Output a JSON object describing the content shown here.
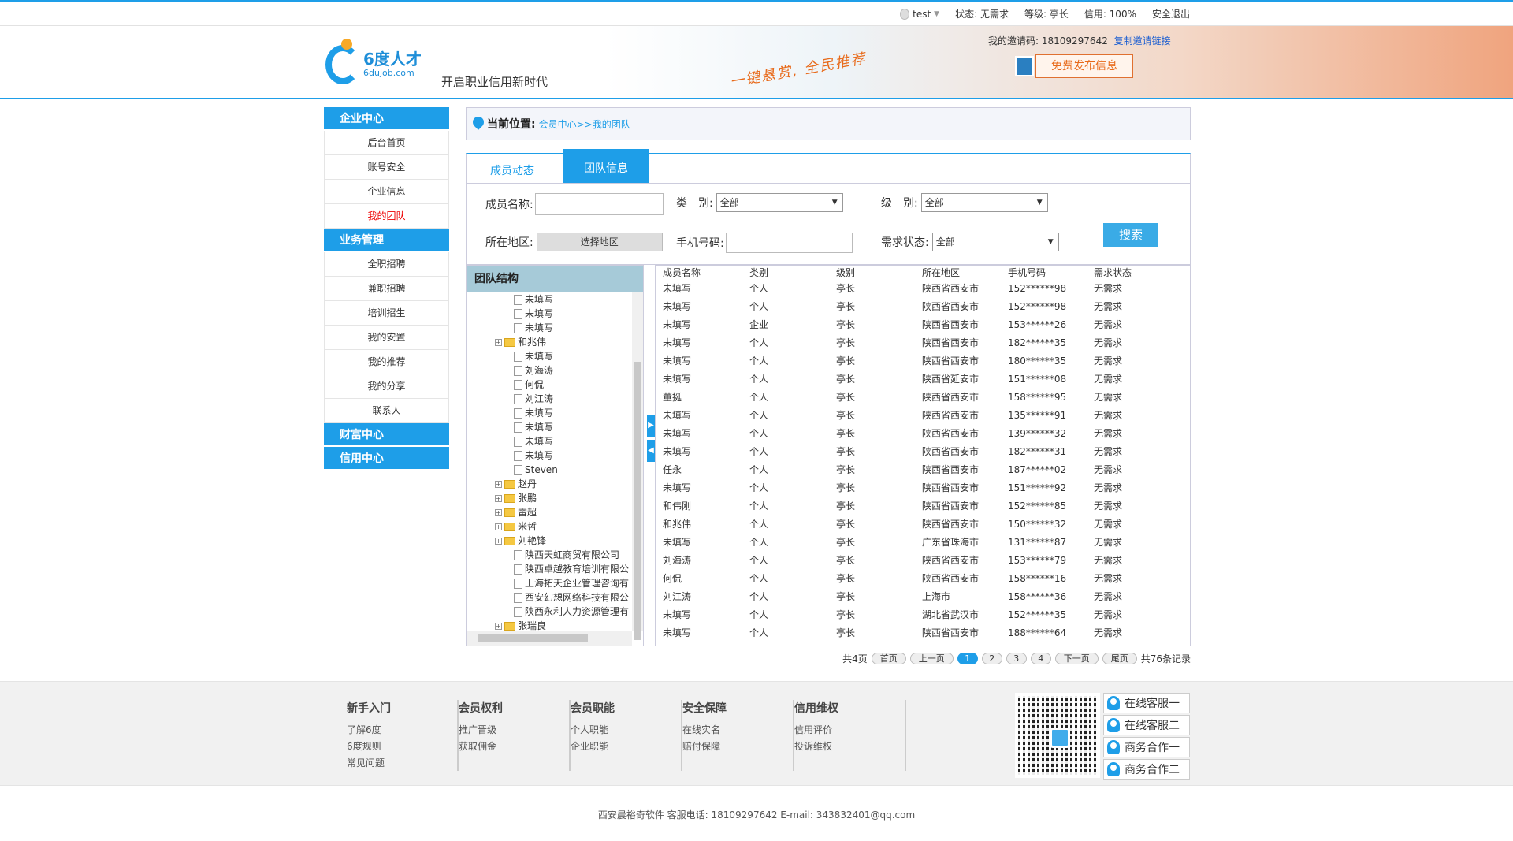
{
  "topbar": {
    "user": "test",
    "status": "状态: 无需求",
    "level": "等级: 亭长",
    "credit": "信用: 100%",
    "logout": "安全退出"
  },
  "banner": {
    "logo_cn": "6度人才",
    "logo_en": "6dujob.com",
    "slogan": "开启职业信用新时代",
    "script_text": "一键悬赏, 全民推荐",
    "invite_label": "我的邀请码: 18109297642",
    "invite_link": "复制邀请链接",
    "publish_button": "免费发布信息"
  },
  "sidebar": {
    "sections": [
      {
        "title": "企业中心",
        "items": [
          "后台首页",
          "账号安全",
          "企业信息",
          "我的团队"
        ]
      },
      {
        "title": "业务管理",
        "items": [
          "全职招聘",
          "兼职招聘",
          "培训招生",
          "我的安置",
          "我的推荐",
          "我的分享",
          "联系人"
        ]
      },
      {
        "title": "财富中心",
        "items": []
      },
      {
        "title": "信用中心",
        "items": []
      }
    ],
    "active": "我的团队"
  },
  "location": {
    "label": "当前位置:",
    "path": "会员中心>>我的团队"
  },
  "tabs": [
    "成员动态",
    "团队信息"
  ],
  "filters": {
    "member_name": "成员名称:",
    "category": "类　别:",
    "category_value": "全部",
    "level": "级　别:",
    "level_value": "全部",
    "region": "所在地区:",
    "region_button": "选择地区",
    "phone": "手机号码:",
    "need_status": "需求状态:",
    "need_status_value": "全部",
    "search_button": "搜索"
  },
  "tree": {
    "title": "团队结构",
    "nodes": [
      {
        "t": "file",
        "label": "未填写"
      },
      {
        "t": "file",
        "label": "未填写"
      },
      {
        "t": "file",
        "label": "未填写"
      },
      {
        "t": "folder",
        "label": "和兆伟"
      },
      {
        "t": "file",
        "label": "未填写"
      },
      {
        "t": "file",
        "label": "刘海涛"
      },
      {
        "t": "file",
        "label": "何侃"
      },
      {
        "t": "file",
        "label": "刘江涛"
      },
      {
        "t": "file",
        "label": "未填写"
      },
      {
        "t": "file",
        "label": "未填写"
      },
      {
        "t": "file",
        "label": "未填写"
      },
      {
        "t": "file",
        "label": "未填写"
      },
      {
        "t": "file",
        "label": "Steven"
      },
      {
        "t": "folder",
        "label": "赵丹"
      },
      {
        "t": "folder",
        "label": "张鹏"
      },
      {
        "t": "folder",
        "label": "雷超"
      },
      {
        "t": "folder",
        "label": "米哲"
      },
      {
        "t": "folder",
        "label": "刘艳锋"
      },
      {
        "t": "file",
        "label": "陕西天虹商贸有限公司"
      },
      {
        "t": "file",
        "label": "陕西卓越教育培训有限公"
      },
      {
        "t": "file",
        "label": "上海拓天企业管理咨询有"
      },
      {
        "t": "file",
        "label": "西安幻想网络科技有限公"
      },
      {
        "t": "file",
        "label": "陕西永利人力资源管理有"
      },
      {
        "t": "folder",
        "label": "张瑞良"
      }
    ]
  },
  "table": {
    "headers": [
      "成员名称",
      "类别",
      "级别",
      "所在地区",
      "手机号码",
      "需求状态"
    ],
    "rows": [
      [
        "未填写",
        "个人",
        "亭长",
        "陕西省西安市",
        "152******98",
        "无需求"
      ],
      [
        "未填写",
        "个人",
        "亭长",
        "陕西省西安市",
        "152******98",
        "无需求"
      ],
      [
        "未填写",
        "企业",
        "亭长",
        "陕西省西安市",
        "153******26",
        "无需求"
      ],
      [
        "未填写",
        "个人",
        "亭长",
        "陕西省西安市",
        "182******35",
        "无需求"
      ],
      [
        "未填写",
        "个人",
        "亭长",
        "陕西省西安市",
        "180******35",
        "无需求"
      ],
      [
        "未填写",
        "个人",
        "亭长",
        "陕西省延安市",
        "151******08",
        "无需求"
      ],
      [
        "董挺",
        "个人",
        "亭长",
        "陕西省西安市",
        "158******95",
        "无需求"
      ],
      [
        "未填写",
        "个人",
        "亭长",
        "陕西省西安市",
        "135******91",
        "无需求"
      ],
      [
        "未填写",
        "个人",
        "亭长",
        "陕西省西安市",
        "139******32",
        "无需求"
      ],
      [
        "未填写",
        "个人",
        "亭长",
        "陕西省西安市",
        "182******31",
        "无需求"
      ],
      [
        "任永",
        "个人",
        "亭长",
        "陕西省西安市",
        "187******02",
        "无需求"
      ],
      [
        "未填写",
        "个人",
        "亭长",
        "陕西省西安市",
        "151******92",
        "无需求"
      ],
      [
        "和伟刚",
        "个人",
        "亭长",
        "陕西省西安市",
        "152******85",
        "无需求"
      ],
      [
        "和兆伟",
        "个人",
        "亭长",
        "陕西省西安市",
        "150******32",
        "无需求"
      ],
      [
        "未填写",
        "个人",
        "亭长",
        "广东省珠海市",
        "131******87",
        "无需求"
      ],
      [
        "刘海涛",
        "个人",
        "亭长",
        "陕西省西安市",
        "153******79",
        "无需求"
      ],
      [
        "何侃",
        "个人",
        "亭长",
        "陕西省西安市",
        "158******16",
        "无需求"
      ],
      [
        "刘江涛",
        "个人",
        "亭长",
        "上海市",
        "158******36",
        "无需求"
      ],
      [
        "未填写",
        "个人",
        "亭长",
        "湖北省武汉市",
        "152******35",
        "无需求"
      ],
      [
        "未填写",
        "个人",
        "亭长",
        "陕西省西安市",
        "188******64",
        "无需求"
      ]
    ]
  },
  "pager": {
    "total_pages": "共4页",
    "first": "首页",
    "prev": "上一页",
    "pages": [
      "1",
      "2",
      "3",
      "4"
    ],
    "current": "1",
    "next": "下一页",
    "last": "尾页",
    "total_records": "共76条记录"
  },
  "footer": {
    "columns": [
      {
        "title": "新手入门",
        "links": [
          "了解6度",
          "6度规则",
          "常见问题"
        ]
      },
      {
        "title": "会员权利",
        "links": [
          "推广晋级",
          "获取佣金"
        ]
      },
      {
        "title": "会员职能",
        "links": [
          "个人职能",
          "企业职能"
        ]
      },
      {
        "title": "安全保障",
        "links": [
          "在线实名",
          "赔付保障"
        ]
      },
      {
        "title": "信用维权",
        "links": [
          "信用评价",
          "投诉维权"
        ]
      }
    ],
    "service": [
      "在线客服一",
      "在线客服二",
      "商务合作一",
      "商务合作二"
    ],
    "copyright": "西安晨裕奇软件 客服电话: 18109297642 E-mail: 343832401@qq.com"
  },
  "colors": {
    "accent": "#1e9ee8",
    "active_link": "#ee0000",
    "publish": "#e86a1a"
  }
}
